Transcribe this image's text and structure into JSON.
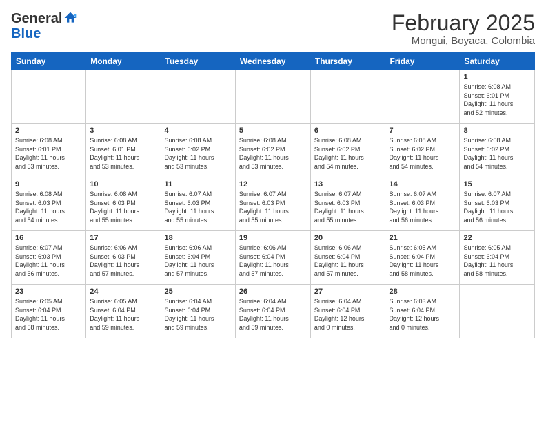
{
  "header": {
    "logo_general": "General",
    "logo_blue": "Blue",
    "month": "February 2025",
    "location": "Mongui, Boyaca, Colombia"
  },
  "days_of_week": [
    "Sunday",
    "Monday",
    "Tuesday",
    "Wednesday",
    "Thursday",
    "Friday",
    "Saturday"
  ],
  "weeks": [
    [
      {
        "day": "",
        "info": ""
      },
      {
        "day": "",
        "info": ""
      },
      {
        "day": "",
        "info": ""
      },
      {
        "day": "",
        "info": ""
      },
      {
        "day": "",
        "info": ""
      },
      {
        "day": "",
        "info": ""
      },
      {
        "day": "1",
        "info": "Sunrise: 6:08 AM\nSunset: 6:01 PM\nDaylight: 11 hours\nand 52 minutes."
      }
    ],
    [
      {
        "day": "2",
        "info": "Sunrise: 6:08 AM\nSunset: 6:01 PM\nDaylight: 11 hours\nand 53 minutes."
      },
      {
        "day": "3",
        "info": "Sunrise: 6:08 AM\nSunset: 6:01 PM\nDaylight: 11 hours\nand 53 minutes."
      },
      {
        "day": "4",
        "info": "Sunrise: 6:08 AM\nSunset: 6:02 PM\nDaylight: 11 hours\nand 53 minutes."
      },
      {
        "day": "5",
        "info": "Sunrise: 6:08 AM\nSunset: 6:02 PM\nDaylight: 11 hours\nand 53 minutes."
      },
      {
        "day": "6",
        "info": "Sunrise: 6:08 AM\nSunset: 6:02 PM\nDaylight: 11 hours\nand 54 minutes."
      },
      {
        "day": "7",
        "info": "Sunrise: 6:08 AM\nSunset: 6:02 PM\nDaylight: 11 hours\nand 54 minutes."
      },
      {
        "day": "8",
        "info": "Sunrise: 6:08 AM\nSunset: 6:02 PM\nDaylight: 11 hours\nand 54 minutes."
      }
    ],
    [
      {
        "day": "9",
        "info": "Sunrise: 6:08 AM\nSunset: 6:03 PM\nDaylight: 11 hours\nand 54 minutes."
      },
      {
        "day": "10",
        "info": "Sunrise: 6:08 AM\nSunset: 6:03 PM\nDaylight: 11 hours\nand 55 minutes."
      },
      {
        "day": "11",
        "info": "Sunrise: 6:07 AM\nSunset: 6:03 PM\nDaylight: 11 hours\nand 55 minutes."
      },
      {
        "day": "12",
        "info": "Sunrise: 6:07 AM\nSunset: 6:03 PM\nDaylight: 11 hours\nand 55 minutes."
      },
      {
        "day": "13",
        "info": "Sunrise: 6:07 AM\nSunset: 6:03 PM\nDaylight: 11 hours\nand 55 minutes."
      },
      {
        "day": "14",
        "info": "Sunrise: 6:07 AM\nSunset: 6:03 PM\nDaylight: 11 hours\nand 56 minutes."
      },
      {
        "day": "15",
        "info": "Sunrise: 6:07 AM\nSunset: 6:03 PM\nDaylight: 11 hours\nand 56 minutes."
      }
    ],
    [
      {
        "day": "16",
        "info": "Sunrise: 6:07 AM\nSunset: 6:03 PM\nDaylight: 11 hours\nand 56 minutes."
      },
      {
        "day": "17",
        "info": "Sunrise: 6:06 AM\nSunset: 6:03 PM\nDaylight: 11 hours\nand 57 minutes."
      },
      {
        "day": "18",
        "info": "Sunrise: 6:06 AM\nSunset: 6:04 PM\nDaylight: 11 hours\nand 57 minutes."
      },
      {
        "day": "19",
        "info": "Sunrise: 6:06 AM\nSunset: 6:04 PM\nDaylight: 11 hours\nand 57 minutes."
      },
      {
        "day": "20",
        "info": "Sunrise: 6:06 AM\nSunset: 6:04 PM\nDaylight: 11 hours\nand 57 minutes."
      },
      {
        "day": "21",
        "info": "Sunrise: 6:05 AM\nSunset: 6:04 PM\nDaylight: 11 hours\nand 58 minutes."
      },
      {
        "day": "22",
        "info": "Sunrise: 6:05 AM\nSunset: 6:04 PM\nDaylight: 11 hours\nand 58 minutes."
      }
    ],
    [
      {
        "day": "23",
        "info": "Sunrise: 6:05 AM\nSunset: 6:04 PM\nDaylight: 11 hours\nand 58 minutes."
      },
      {
        "day": "24",
        "info": "Sunrise: 6:05 AM\nSunset: 6:04 PM\nDaylight: 11 hours\nand 59 minutes."
      },
      {
        "day": "25",
        "info": "Sunrise: 6:04 AM\nSunset: 6:04 PM\nDaylight: 11 hours\nand 59 minutes."
      },
      {
        "day": "26",
        "info": "Sunrise: 6:04 AM\nSunset: 6:04 PM\nDaylight: 11 hours\nand 59 minutes."
      },
      {
        "day": "27",
        "info": "Sunrise: 6:04 AM\nSunset: 6:04 PM\nDaylight: 12 hours\nand 0 minutes."
      },
      {
        "day": "28",
        "info": "Sunrise: 6:03 AM\nSunset: 6:04 PM\nDaylight: 12 hours\nand 0 minutes."
      },
      {
        "day": "",
        "info": ""
      }
    ]
  ]
}
